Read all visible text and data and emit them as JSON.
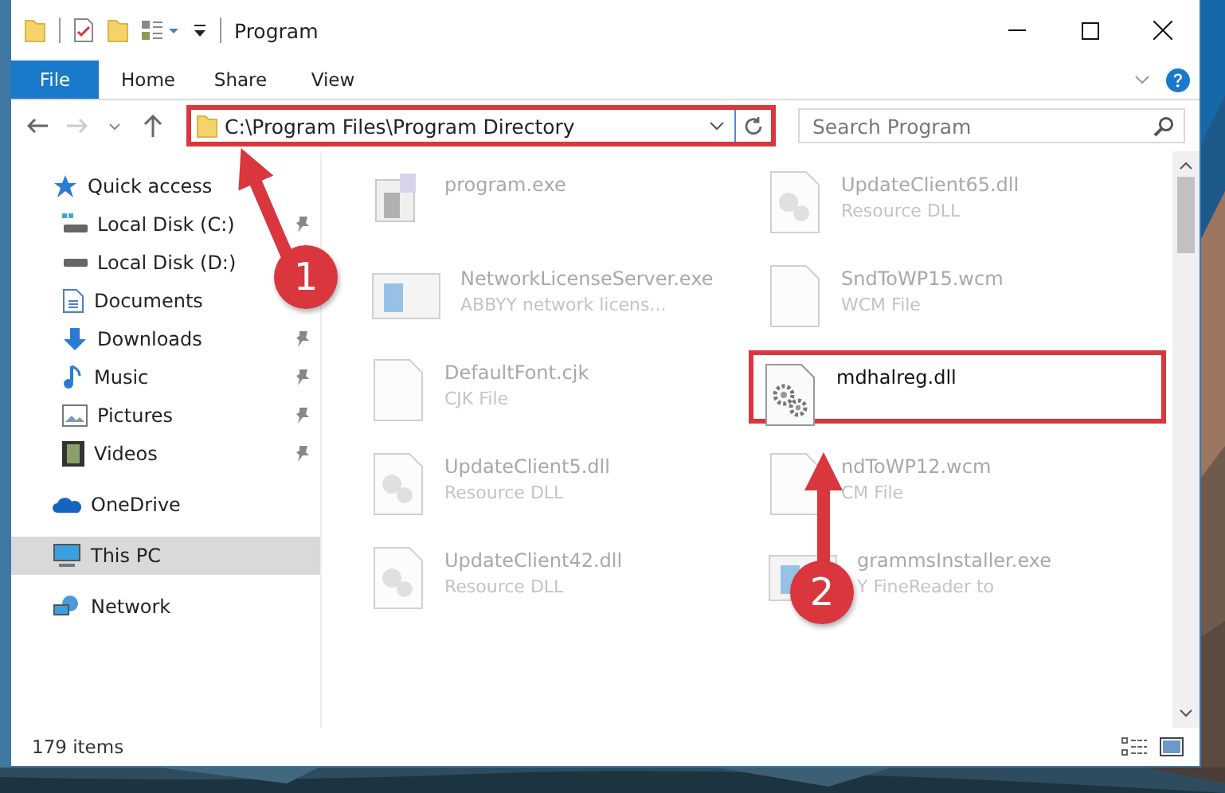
{
  "window": {
    "title": "Program"
  },
  "ribbon_tabs": [
    {
      "label": "File",
      "kind": "menu"
    },
    {
      "label": "Home",
      "kind": "tab"
    },
    {
      "label": "Share",
      "kind": "tab"
    },
    {
      "label": "View",
      "kind": "tab"
    }
  ],
  "address": {
    "path": "C:\\Program Files\\Program Directory",
    "highlighted": true
  },
  "search": {
    "placeholder": "Search Program"
  },
  "nav": [
    {
      "label": "Quick access",
      "selected": false,
      "children": [
        {
          "label": "Local Disk (C:)",
          "pinned": true,
          "selected": false
        },
        {
          "label": "Local Disk (D:)",
          "pinned": false,
          "selected": false
        },
        {
          "label": "Documents",
          "pinned": false,
          "selected": false
        },
        {
          "label": "Downloads",
          "pinned": true,
          "selected": false
        },
        {
          "label": "Music",
          "pinned": true,
          "selected": false
        },
        {
          "label": "Pictures",
          "pinned": true,
          "selected": false
        },
        {
          "label": "Videos",
          "pinned": true,
          "selected": false
        }
      ]
    },
    {
      "label": "OneDrive",
      "selected": false
    },
    {
      "label": "This PC",
      "selected": true
    },
    {
      "label": "Network",
      "selected": false
    }
  ],
  "files": [
    {
      "name": "program.exe",
      "kind": "app",
      "faded": true,
      "highlighted": false
    },
    {
      "name": "UpdateClient65.dll",
      "type": "Resource DLL",
      "kind": "dll",
      "faded": true,
      "highlighted": false
    },
    {
      "name": "NetworkLicenseServer.exe",
      "type": "ABBYY network licens...",
      "kind": "window",
      "faded": true,
      "highlighted": false
    },
    {
      "name": "SndToWP15.wcm",
      "type": "WCM File",
      "kind": "doc",
      "faded": true,
      "highlighted": false
    },
    {
      "name": "DefaultFont.cjk",
      "type": "CJK File",
      "kind": "doc",
      "faded": true,
      "highlighted": false
    },
    {
      "name": "mdhalreg.dll",
      "kind": "gears",
      "faded": false,
      "highlighted": true
    },
    {
      "name": "UpdateClient5.dll",
      "type": "Resource DLL",
      "kind": "dll",
      "faded": true,
      "highlighted": false
    },
    {
      "name": "ndToWP12.wcm",
      "type": "CM File",
      "kind": "doc",
      "faded": true,
      "highlighted": false
    },
    {
      "name": "UpdateClient42.dll",
      "type": "Resource DLL",
      "kind": "dll",
      "faded": true,
      "highlighted": false
    },
    {
      "name": "grammsInstaller.exe",
      "type": "Y FineReader to",
      "kind": "window",
      "faded": true,
      "highlighted": false
    }
  ],
  "status_bar": {
    "item_count": "179 items"
  },
  "annotations": [
    {
      "number": "1"
    },
    {
      "number": "2"
    }
  ]
}
